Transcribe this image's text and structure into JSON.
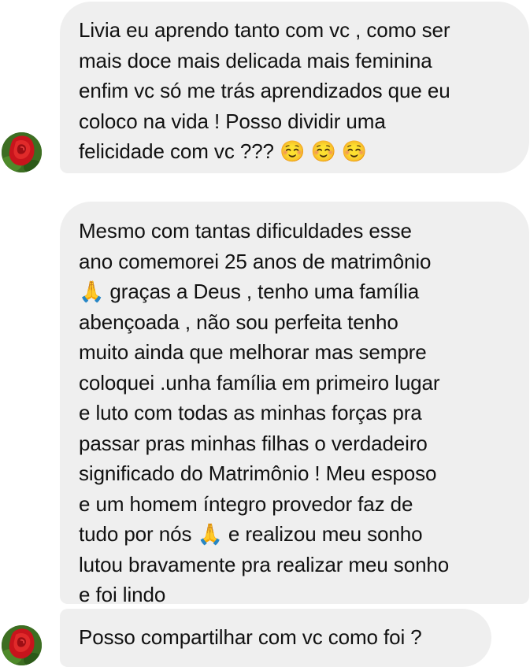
{
  "conversation": {
    "colors": {
      "bubble_background": "#efefef",
      "text": "#111111",
      "page_background": "#ffffff"
    },
    "avatar": {
      "icon": "red-rose-avatar"
    },
    "messages": [
      {
        "lines": [
          "Livia eu aprendo tanto com vc , como ser",
          "mais doce mais delicada mais feminina",
          "enfim vc só me trás aprendizados que eu",
          "coloco na vida  ! Posso dividir uma",
          "felicidade com vc ??? ☺️ ☺️ ☺️"
        ]
      },
      {
        "lines": [
          "Mesmo com tantas dificuldades esse",
          "ano comemorei 25 anos de matrimônio",
          "🙏 graças a Deus , tenho uma família",
          "abençoada , não sou perfeita tenho",
          "muito ainda que melhorar mas sempre",
          "coloquei .unha família em primeiro lugar",
          "e luto com todas as minhas forças pra",
          "passar pras minhas filhas o verdadeiro",
          "significado do Matrimônio ! Meu esposo",
          "e um homem íntegro provedor faz de",
          "tudo por nós 🙏 e realizou meu sonho",
          "lutou bravamente pra realizar meu sonho",
          "e foi lindo"
        ]
      },
      {
        "lines": [
          "Posso compartilhar com vc como foi ?"
        ]
      }
    ]
  }
}
